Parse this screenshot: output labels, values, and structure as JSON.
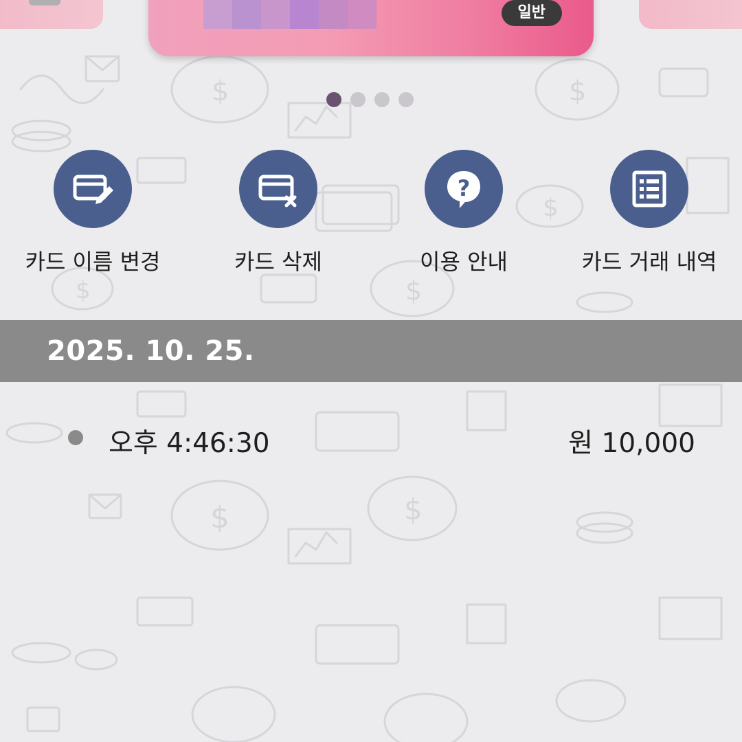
{
  "card": {
    "badge": "일반",
    "colors": {
      "gradient_start": "#f1a0bd",
      "gradient_end": "#ea5a8a",
      "stripes": [
        "#c89ed0",
        "#bb92d0",
        "#c996cc",
        "#b886d0",
        "#c48ac4",
        "#d08bc0"
      ]
    }
  },
  "carousel": {
    "page_count": 4,
    "active_index": 0
  },
  "actions": [
    {
      "label": "카드 이름 변경",
      "icon": "card-edit-icon"
    },
    {
      "label": "카드 삭제",
      "icon": "card-delete-icon"
    },
    {
      "label": "이용 안내",
      "icon": "question-bubble-icon"
    },
    {
      "label": "카드 거래 내역",
      "icon": "list-document-icon"
    }
  ],
  "history": {
    "date": "2025. 10. 25.",
    "transactions": [
      {
        "time": "오후 4:46:30",
        "amount": "원 10,000"
      }
    ]
  },
  "theme": {
    "action_circle": "#4a5f8d",
    "date_band": "#8a8a8a",
    "background": "#ececee"
  }
}
